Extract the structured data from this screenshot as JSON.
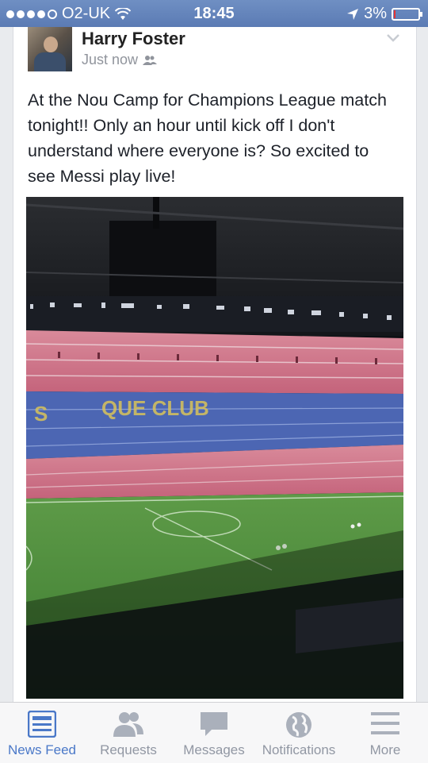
{
  "status_bar": {
    "carrier": "O2-UK",
    "time": "18:45",
    "battery": "3%",
    "battery_level": 0.03
  },
  "post": {
    "author": "Harry Foster",
    "timestamp": "Just now",
    "text": "At the Nou Camp for Champions League match tonight!! Only an hour until kick off I don't understand where everyone is? So excited to see Messi play live!",
    "photo_signage": "QUE CLUB"
  },
  "tab_bar": {
    "tabs": [
      {
        "label": "News Feed",
        "icon": "news-feed-icon",
        "active": true
      },
      {
        "label": "Requests",
        "icon": "requests-icon",
        "active": false
      },
      {
        "label": "Messages",
        "icon": "messages-icon",
        "active": false
      },
      {
        "label": "Notifications",
        "icon": "notifications-globe-icon",
        "active": false
      },
      {
        "label": "More",
        "icon": "more-menu-icon",
        "active": false
      }
    ]
  },
  "colors": {
    "status_bar": "#5b7bb4",
    "active_tab": "#4a78c8",
    "inactive_tab": "#9197a3",
    "battery_low": "#e33333"
  }
}
